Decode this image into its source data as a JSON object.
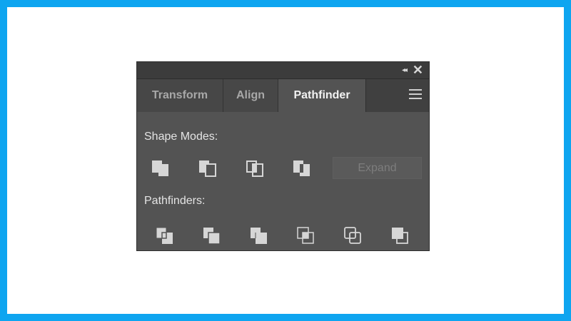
{
  "panel": {
    "titlebar": {
      "collapse_icon": "double-chevron-left-icon",
      "collapse_glyph": "◂◂",
      "close_icon": "close-icon",
      "close_glyph": "✕"
    },
    "tabs": [
      {
        "label": "Transform",
        "active": false
      },
      {
        "label": "Align",
        "active": false
      },
      {
        "label": "Pathfinder",
        "active": true
      }
    ],
    "menu_icon": "hamburger-menu-icon",
    "shape_modes": {
      "label": "Shape Modes:",
      "buttons": [
        "unite-icon",
        "minus-front-icon",
        "intersect-icon",
        "exclude-icon"
      ],
      "expand_label": "Expand",
      "expand_enabled": false
    },
    "pathfinders": {
      "label": "Pathfinders:",
      "buttons": [
        "divide-icon",
        "trim-icon",
        "merge-icon",
        "crop-icon",
        "outline-icon",
        "minus-back-icon"
      ]
    }
  },
  "colors": {
    "frame_border": "#0ea5f0",
    "panel_bg": "#535353",
    "tab_bar_bg": "#404040",
    "text": "#e4e4e4"
  }
}
